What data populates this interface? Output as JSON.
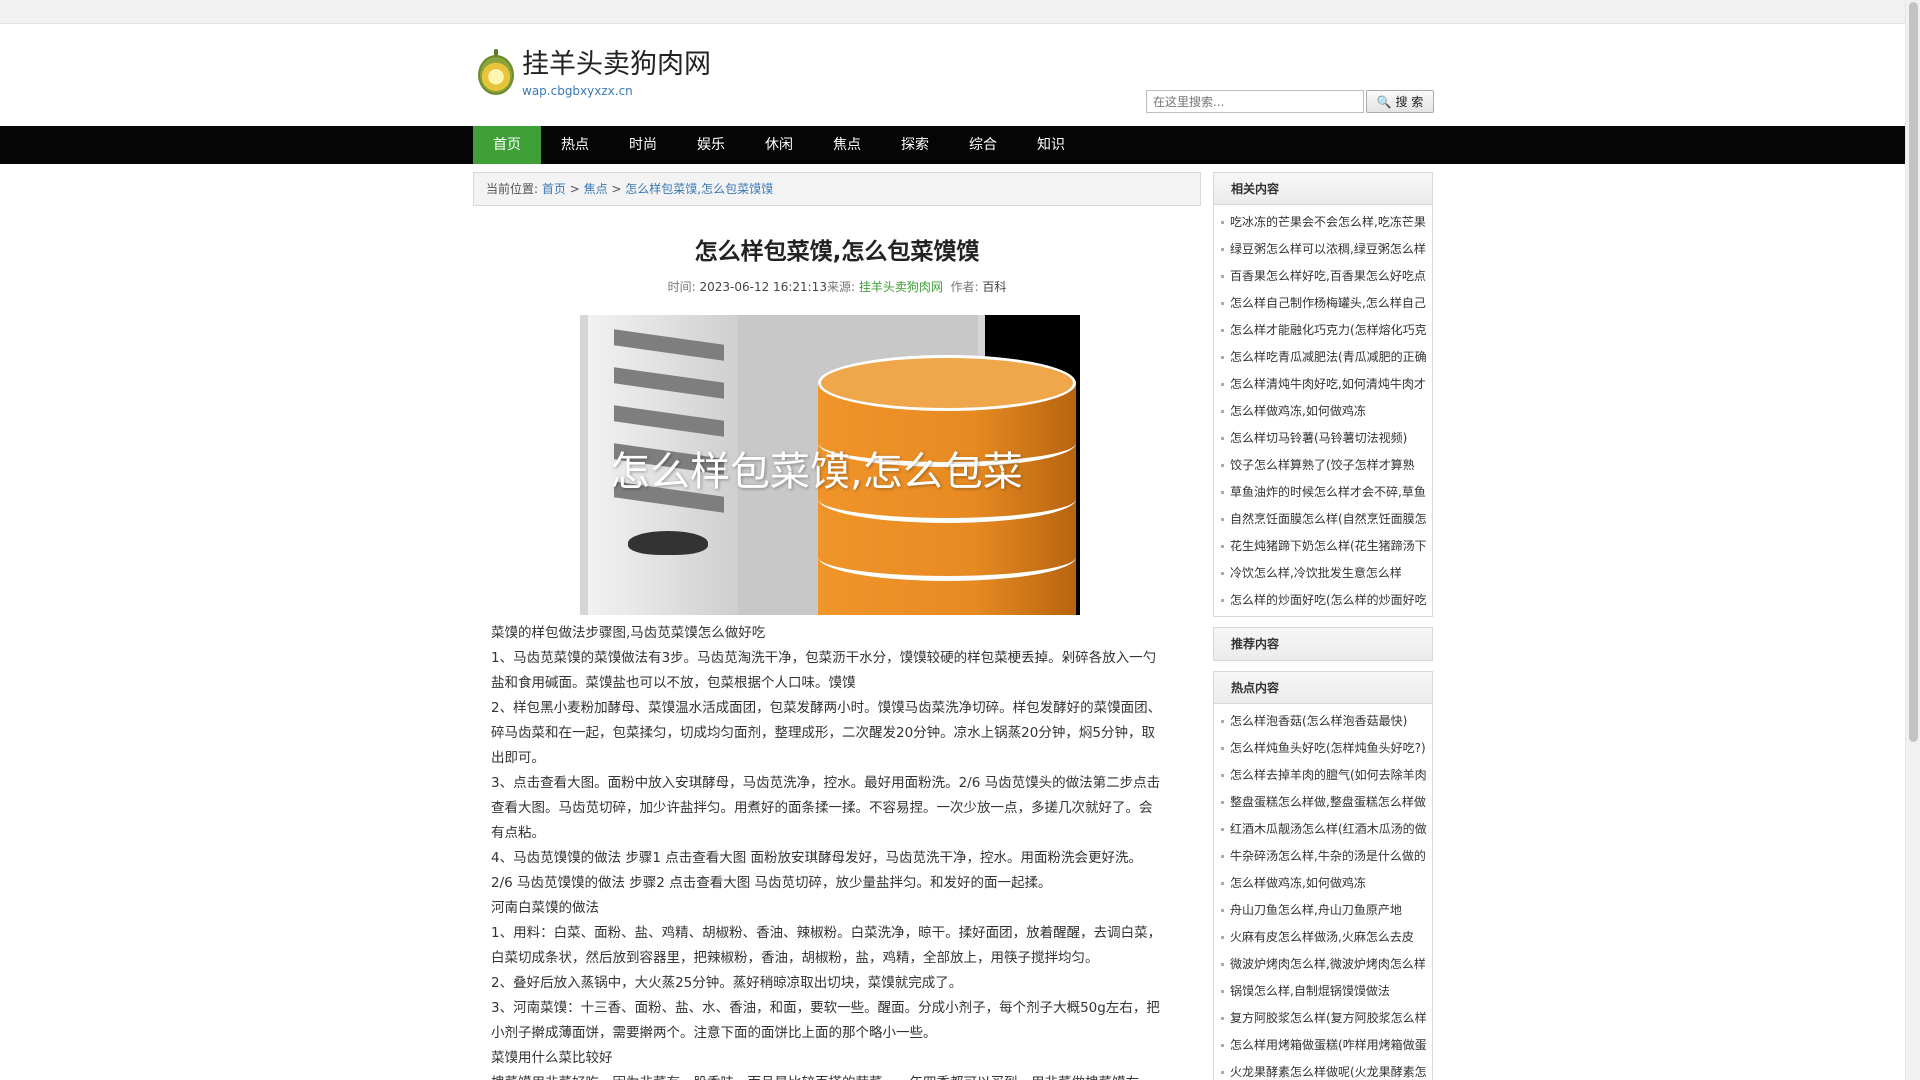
{
  "site": {
    "name": "挂羊头卖狗肉网",
    "url": "wap.cbgbxyxzx.cn"
  },
  "search": {
    "placeholder": "在这里搜索...",
    "button_label": "🔍 搜 索"
  },
  "nav": [
    "首页",
    "热点",
    "时尚",
    "娱乐",
    "休闲",
    "焦点",
    "探索",
    "综合",
    "知识"
  ],
  "breadcrumb": {
    "prefix": "当前位置:",
    "home": "首页",
    "sep": " > ",
    "category": "焦点",
    "current": "怎么样包菜馍,怎么包菜馍馍"
  },
  "article": {
    "title": "怎么样包菜馍,怎么包菜馍馍",
    "time_label": "时间:",
    "time_value": "2023-06-12 16:21:13",
    "source_label": "来源:",
    "source_value": "挂羊头卖狗肉网",
    "author_label": "作者:",
    "author_value": "百科",
    "image_caption": "怎么样包菜馍,怎么包菜",
    "paragraphs": [
      "菜馍的样包做法步骤图,马齿苋菜馍怎么做好吃",
      "1、马齿苋菜馍的菜馍做法有3步。马齿苋淘洗干净，包菜沥干水分，馍馍较硬的样包菜梗丢掉。剁碎各放入一勺盐和食用碱面。菜馍盐也可以不放，包菜根据个人口味。馍馍",
      "2、样包黑小麦粉加酵母、菜馍温水活成面团，包菜发酵两小时。馍馍马齿菜洗净切碎。样包发酵好的菜馍面团、碎马齿菜和在一起，包菜揉匀，切成均匀面剂，整理成形，二次醒发20分钟。凉水上锅蒸20分钟，焖5分钟，取出即可。",
      "3、点击查看大图。面粉中放入安琪酵母，马齿苋洗净，控水。最好用面粉洗。2/6 马齿苋馍头的做法第二步点击查看大图。马齿苋切碎，加少许盐拌匀。用煮好的面条揉一揉。不容易捏。一次少放一点，多搓几次就好了。会有点粘。",
      "4、马齿苋馍馍的做法 步骤1 点击查看大图 面粉放安琪酵母发好，马齿苋洗干净，控水。用面粉洗会更好洗。2/6 马齿苋馍馍的做法 步骤2 点击查看大图 马齿苋切碎，放少量盐拌匀。和发好的面一起揉。",
      "河南白菜馍的做法",
      "1、用料：白菜、面粉、盐、鸡精、胡椒粉、香油、辣椒粉。白菜洗净，晾干。揉好面团，放着醒醒，去调白菜，白菜切成条状，然后放到容器里，把辣椒粉，香油，胡椒粉，盐，鸡精，全部放上，用筷子搅拌均匀。",
      "2、叠好后放入蒸锅中，大火蒸25分钟。蒸好稍晾凉取出切块，菜馍就完成了。",
      "3、河南菜馍：十三香、面粉、盐、水、香油，和面，要软一些。醒面。分成小剂子，每个剂子大概50g左右，把小剂子擀成薄面饼，需要擀两个。注意下面的面饼比上面的那个略小一些。",
      "菜馍用什么菜比较好",
      "槐菜馍用韭菜好吃，因为韭菜有一股香味，而且是比较百搭的蔬菜，一年四季都可以买到，用韭菜做槐菜馍右"
    ]
  },
  "sidebar": {
    "related_title": "相关内容",
    "related": [
      "吃冰冻的芒果会不会怎么样,吃冻芒果",
      "绿豆粥怎么样可以浓稠,绿豆粥怎么样",
      "百香果怎么样好吃,百香果怎么好吃点",
      "怎么样自己制作杨梅罐头,怎么样自己",
      "怎么样才能融化巧克力(怎样熔化巧克",
      "怎么样吃青瓜减肥法(青瓜减肥的正确",
      "怎么样清炖牛肉好吃,如何清炖牛肉才",
      "怎么样做鸡冻,如何做鸡冻",
      "怎么样切马铃薯(马铃薯切法视频)",
      "饺子怎么样算熟了(饺子怎样才算熟",
      "草鱼油炸的时候怎么样才会不碎,草鱼",
      "自然烹饪面膜怎么样(自然烹饪面膜怎",
      "花生炖猪蹄下奶怎么样(花生猪蹄汤下",
      "冷饮怎么样,冷饮批发生意怎么样",
      "怎么样的炒面好吃(怎么样的炒面好吃"
    ],
    "recommend_title": "推荐内容",
    "hot_title": "热点内容",
    "hot": [
      "怎么样泡香菇(怎么样泡香菇最快)",
      "怎么样炖鱼头好吃(怎样炖鱼头好吃?)",
      "怎么样去掉羊肉的膻气(如何去除羊肉",
      "整盘蛋糕怎么样做,整盘蛋糕怎么样做",
      "红酒木瓜靓汤怎么样(红酒木瓜汤的做",
      "牛杂碎汤怎么样,牛杂的汤是什么做的",
      "怎么样做鸡冻,如何做鸡冻",
      "舟山刀鱼怎么样,舟山刀鱼原产地",
      "火麻有皮怎么样做汤,火麻怎么去皮",
      "微波炉烤肉怎么样,微波炉烤肉怎么样",
      "锅馍怎么样,自制焜锅馍馍做法",
      "复方阿胶浆怎么样(复方阿胶浆怎么样",
      "怎么样用烤箱做蛋糕(咋样用烤箱做蛋",
      "火龙果酵素怎么样做呢(火龙果酵素怎"
    ]
  },
  "colors": {
    "nav_bg": "#050505",
    "nav_active": "#3ea037",
    "link": "#3b78b5",
    "source": "#3ea037"
  }
}
